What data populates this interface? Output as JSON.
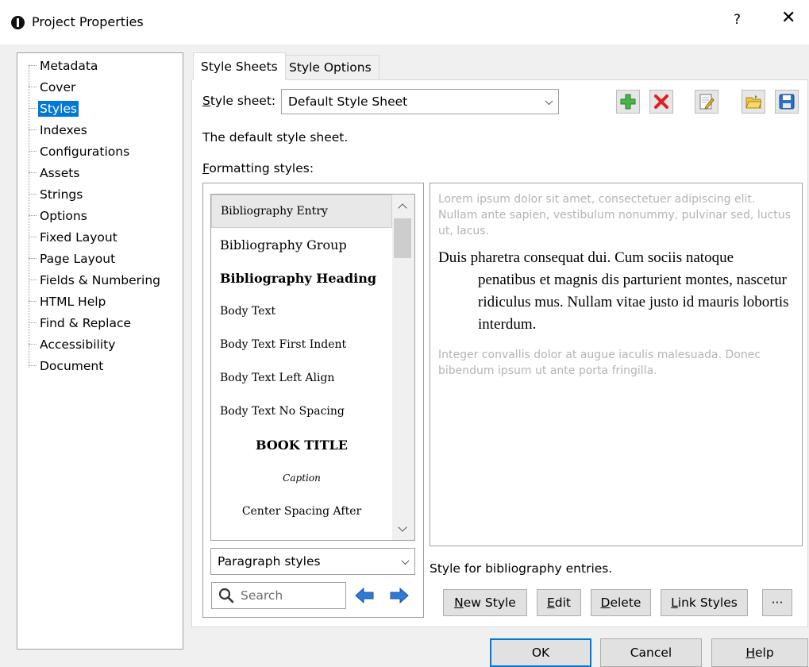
{
  "window": {
    "title": "Project Properties",
    "help_label": "?",
    "close_label": "✕"
  },
  "tree": {
    "items": [
      {
        "label": "Metadata"
      },
      {
        "label": "Cover"
      },
      {
        "label": "Styles",
        "selected": true
      },
      {
        "label": "Indexes"
      },
      {
        "label": "Configurations"
      },
      {
        "label": "Assets"
      },
      {
        "label": "Strings"
      },
      {
        "label": "Options"
      },
      {
        "label": "Fixed Layout"
      },
      {
        "label": "Page Layout"
      },
      {
        "label": "Fields & Numbering"
      },
      {
        "label": "HTML Help"
      },
      {
        "label": "Find & Replace"
      },
      {
        "label": "Accessibility"
      },
      {
        "label": "Document"
      }
    ]
  },
  "tabs": [
    {
      "label": "Style Sheets",
      "active": true
    },
    {
      "label": "Style Options",
      "active": false
    }
  ],
  "stylesheet": {
    "label": "Style sheet:",
    "label_accel": "S",
    "label_rest": "tyle sheet:",
    "value": "Default Style Sheet",
    "description": "The default style sheet."
  },
  "toolbar": {
    "add_icon": "plus-icon",
    "delete_icon": "red-x-icon",
    "edit_icon": "edit-document-icon",
    "open_icon": "open-folder-icon",
    "save_icon": "save-disk-icon"
  },
  "formatting": {
    "label_accel": "F",
    "label_rest": "ormatting styles:"
  },
  "styles_list": [
    {
      "label": "Bibliography Entry",
      "selected": true,
      "weight": "normal",
      "align": "left",
      "size": 14
    },
    {
      "label": "Bibliography Group",
      "selected": false,
      "weight": "normal",
      "align": "left",
      "size": 16
    },
    {
      "label": "Bibliography Heading",
      "selected": false,
      "weight": "bold",
      "align": "left",
      "size": 16
    },
    {
      "label": "Body Text",
      "selected": false,
      "weight": "normal",
      "align": "left",
      "size": 14
    },
    {
      "label": "Body Text First Indent",
      "selected": false,
      "weight": "normal",
      "align": "left",
      "size": 14
    },
    {
      "label": "Body Text Left Align",
      "selected": false,
      "weight": "normal",
      "align": "left",
      "size": 14
    },
    {
      "label": "Body Text No Spacing",
      "selected": false,
      "weight": "normal",
      "align": "left",
      "size": 14
    },
    {
      "label": "BOOK TITLE",
      "selected": false,
      "weight": "bold",
      "align": "center",
      "size": 16
    },
    {
      "label": "Caption",
      "selected": false,
      "weight": "normal",
      "align": "center",
      "size": 12,
      "italic": true
    },
    {
      "label": "Center Spacing After",
      "selected": false,
      "weight": "normal",
      "align": "center",
      "size": 14
    }
  ],
  "style_type": {
    "value": "Paragraph styles"
  },
  "search": {
    "placeholder": "Search"
  },
  "preview": {
    "before": "Lorem ipsum dolor sit amet, consectetuer adipiscing elit. Nullam ante sapien, vestibulum nonummy, pulvinar sed, luctus ut, lacus.",
    "sample": "Duis pharetra consequat dui. Cum sociis natoque penatibus et magnis dis parturient montes, nascetur ridiculus mus. Nullam vitae justo id mauris lobortis interdum.",
    "after": "Integer convallis dolor at augue iaculis malesuada. Donec bibendum ipsum ut ante porta fringilla."
  },
  "style_description": "Style for bibliography entries.",
  "actions": {
    "new_style_accel": "N",
    "new_style_rest": "ew Style",
    "edit_accel": "E",
    "edit_rest": "dit",
    "delete_accel": "D",
    "delete_rest": "elete",
    "link_accel": "L",
    "link_rest": "ink Styles",
    "more_label": "···"
  },
  "dialog_buttons": {
    "ok": "OK",
    "cancel": "Cancel",
    "help_accel": "H",
    "help_rest": "elp"
  },
  "colors": {
    "selection": "#0078d7",
    "plus_green": "#3aa63a",
    "delete_red": "#e02020",
    "nav_blue": "#2f7ad6"
  }
}
